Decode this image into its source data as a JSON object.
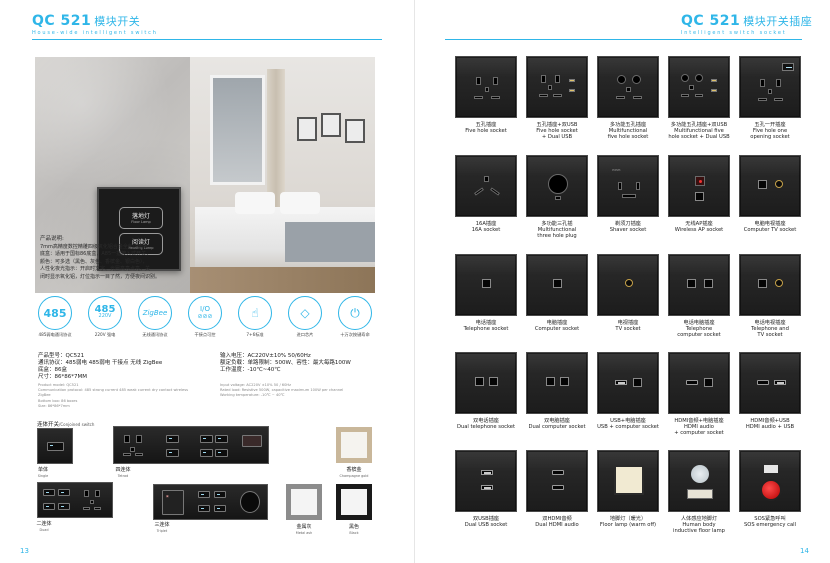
{
  "left_page": {
    "brand": "QC 521",
    "brand_cn": "模块开关",
    "brand_sub": "House-wide intelligent switch",
    "switch_buttons": [
      {
        "cn": "落地灯",
        "en": "Floor Lamp"
      },
      {
        "cn": "阅读灯",
        "en": "Reading Lamp"
      }
    ],
    "description": {
      "heading": "产品说明:",
      "lines": [
        "7mm高精度数控精雕四级氧化铝合金全包边面板，",
        "底盒：适用于国标86底盒，A85一指按入式开关，",
        "颜色：可多选（黑色、灰色、香槟金、银白色），",
        "人性化夜光指示：开启时文字、光圈高亮点亮，关",
        "闭时显示氧化铝，灯位指示一目了然，方便夜间识别。"
      ]
    },
    "badges": [
      {
        "icon": "485",
        "label": "485弱电通讯协议"
      },
      {
        "icon": "485",
        "sub": "220V",
        "label": "220V 强电"
      },
      {
        "icon": "ZigBee",
        "label": "无线通讯协议"
      },
      {
        "icon": "I/O",
        "label": "干接点可控"
      },
      {
        "icon": "7+",
        "label": "7+6标准"
      },
      {
        "icon": "chip",
        "label": "进口芯片"
      },
      {
        "icon": "power",
        "label": "十万次按键寿命"
      }
    ],
    "specs_left": [
      "产品型号：QC521",
      "通讯协议：485弱电  485弱电  干接点  无线  ZigBee",
      "底盒：86盒",
      "尺寸：86*86*7MM"
    ],
    "specs_left_en": [
      "Product model: QC521",
      "Communication protocol: 485 strong current 485 weak current dry contact wireless ZigBee",
      "Bottom box: 86 boxes",
      "Size: 86*86*7mm"
    ],
    "specs_right": [
      "输入电压：AC220V±10%  50/60Hz",
      "额定负载：单路限制：500W、容性：最大每路100W",
      "工作温度：-10℃~40℃"
    ],
    "specs_right_en": [
      "Input voltage: AC220V ±10% 50 / 60Hz",
      "Rated load: Resistive 500W, capacitive maximum 100W per channel",
      "Working temperature: -10℃ ~ 40℃"
    ],
    "combo_title_cn": "连体开关",
    "combo_title_en": "/Conjoined switch",
    "combos": [
      {
        "cn": "单体",
        "en": "Single"
      },
      {
        "cn": "四连体",
        "en": "Tetrad"
      },
      {
        "cn": "二连体",
        "en": "Duad"
      },
      {
        "cn": "三连体",
        "en": "Triplet"
      }
    ],
    "frames": [
      {
        "cn": "香槟金",
        "en": "Champagne gold",
        "color": "#c9b79a"
      },
      {
        "cn": "金属灰",
        "en": "Metal ash",
        "color": "#8c8c8c"
      },
      {
        "cn": "黑色",
        "en": "Black",
        "color": "#1a1a1a"
      }
    ],
    "page_number": "13"
  },
  "right_page": {
    "brand": "QC 521",
    "brand_cn": "模块开关插座",
    "brand_sub": "Intelligent switch socket",
    "page_number": "14",
    "sockets": [
      {
        "cn": "五孔插座",
        "en": [
          "Five hole socket"
        ]
      },
      {
        "cn": "五孔插座+双USB",
        "en": [
          "Five hole socket",
          "+ Dual USB"
        ]
      },
      {
        "cn": "多功能五孔插座",
        "en": [
          "Multifunctional",
          "five hole socket"
        ]
      },
      {
        "cn": "多功能五孔插座+双USB",
        "en": [
          "Multifunctional five",
          "hole socket + Dual USB"
        ]
      },
      {
        "cn": "五孔一开插座",
        "en": [
          "Five hole one",
          "opening socket"
        ]
      },
      {
        "cn": "16A插座",
        "en": [
          "16A socket"
        ]
      },
      {
        "cn": "多功能三孔插",
        "en": [
          "Multifunctional",
          "three hole plug"
        ]
      },
      {
        "cn": "剃须刀插座",
        "en": [
          "Shaver socket"
        ]
      },
      {
        "cn": "无线AP插座",
        "en": [
          "Wireless AP socket"
        ]
      },
      {
        "cn": "电脑电视插座",
        "en": [
          "Computer TV socket"
        ]
      },
      {
        "cn": "电话插座",
        "en": [
          "Telephone socket"
        ]
      },
      {
        "cn": "电脑插座",
        "en": [
          "Computer socket"
        ]
      },
      {
        "cn": "电视插座",
        "en": [
          "TV socket"
        ]
      },
      {
        "cn": "电话电脑插座",
        "en": [
          "Telephone",
          "computer socket"
        ]
      },
      {
        "cn": "电话电视插座",
        "en": [
          "Telephone and",
          "TV socket"
        ]
      },
      {
        "cn": "双电话插座",
        "en": [
          "Dual telephone socket"
        ]
      },
      {
        "cn": "双电脑插座",
        "en": [
          "Dual computer socket"
        ]
      },
      {
        "cn": "USB+电脑插座",
        "en": [
          "USB + computer socket"
        ]
      },
      {
        "cn": "HDMI音频+电脑插座",
        "en": [
          "HDMI audio",
          "+ computer socket"
        ]
      },
      {
        "cn": "HDMI音频+USB",
        "en": [
          "HDMI audio + USB"
        ]
      },
      {
        "cn": "双USB插座",
        "en": [
          "Dual USB socket"
        ]
      },
      {
        "cn": "双HDMI音频",
        "en": [
          "Dual HDMI audio"
        ]
      },
      {
        "cn": "地脚灯（暖光）",
        "en": [
          "Floor lamp (warm off)"
        ]
      },
      {
        "cn": "人体感应地脚灯",
        "en": [
          "Human body",
          "inductive floor lamp"
        ]
      },
      {
        "cn": "SOS紧急呼叫",
        "en": [
          "SOS emergency call"
        ]
      }
    ]
  },
  "colors": {
    "accent": "#2fb6e8",
    "plate": "#1e1e1e"
  }
}
